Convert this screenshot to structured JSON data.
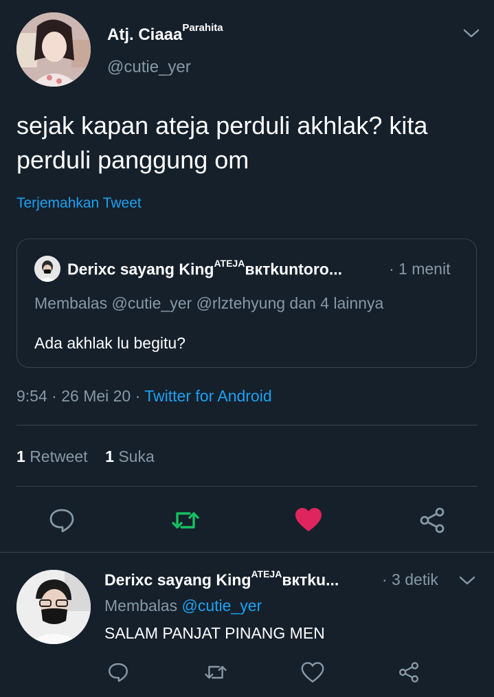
{
  "tweet": {
    "author_name": "Atj. Ciaaa",
    "author_name_sup": "Parahita",
    "author_handle": "@cutie_yer",
    "text": "sejak kapan ateja perduli akhlak? kita perduli panggung om",
    "translate_label": "Terjemahkan Tweet",
    "time": "9:54",
    "date": "26 Mei 20",
    "source": "Twitter for Android",
    "retweet_count": "1",
    "retweet_label": "Retweet",
    "like_count": "1",
    "like_label": "Suka"
  },
  "quote": {
    "author_name_prefix": "Derixc sayang King",
    "author_name_sup": "ATEJA",
    "author_name_suffix": "вктkuntoro...",
    "time": "· 1 menit",
    "replying_prefix": "Membalas",
    "replying_to": "@cutie_yer @rlztehyung dan 4 lainnya",
    "text": "Ada akhlak lu begitu?"
  },
  "reply": {
    "author_name_prefix": "Derixc sayang King",
    "author_name_sup": "ATEJA",
    "author_name_suffix": "вктku...",
    "time": "· 3 detik",
    "replying_prefix": "Membalas",
    "replying_to": "@cutie_yer",
    "text": "SALAM PANJAT PINANG MEN"
  },
  "colors": {
    "background": "#15202b",
    "accent": "#1da1f2",
    "retweeted": "#17bf63",
    "liked": "#e0245e",
    "muted": "#8899a6"
  },
  "icons": {
    "reply": "reply-icon",
    "retweet": "retweet-icon",
    "like": "heart-icon",
    "share": "share-icon",
    "menu": "chevron-down-icon"
  }
}
